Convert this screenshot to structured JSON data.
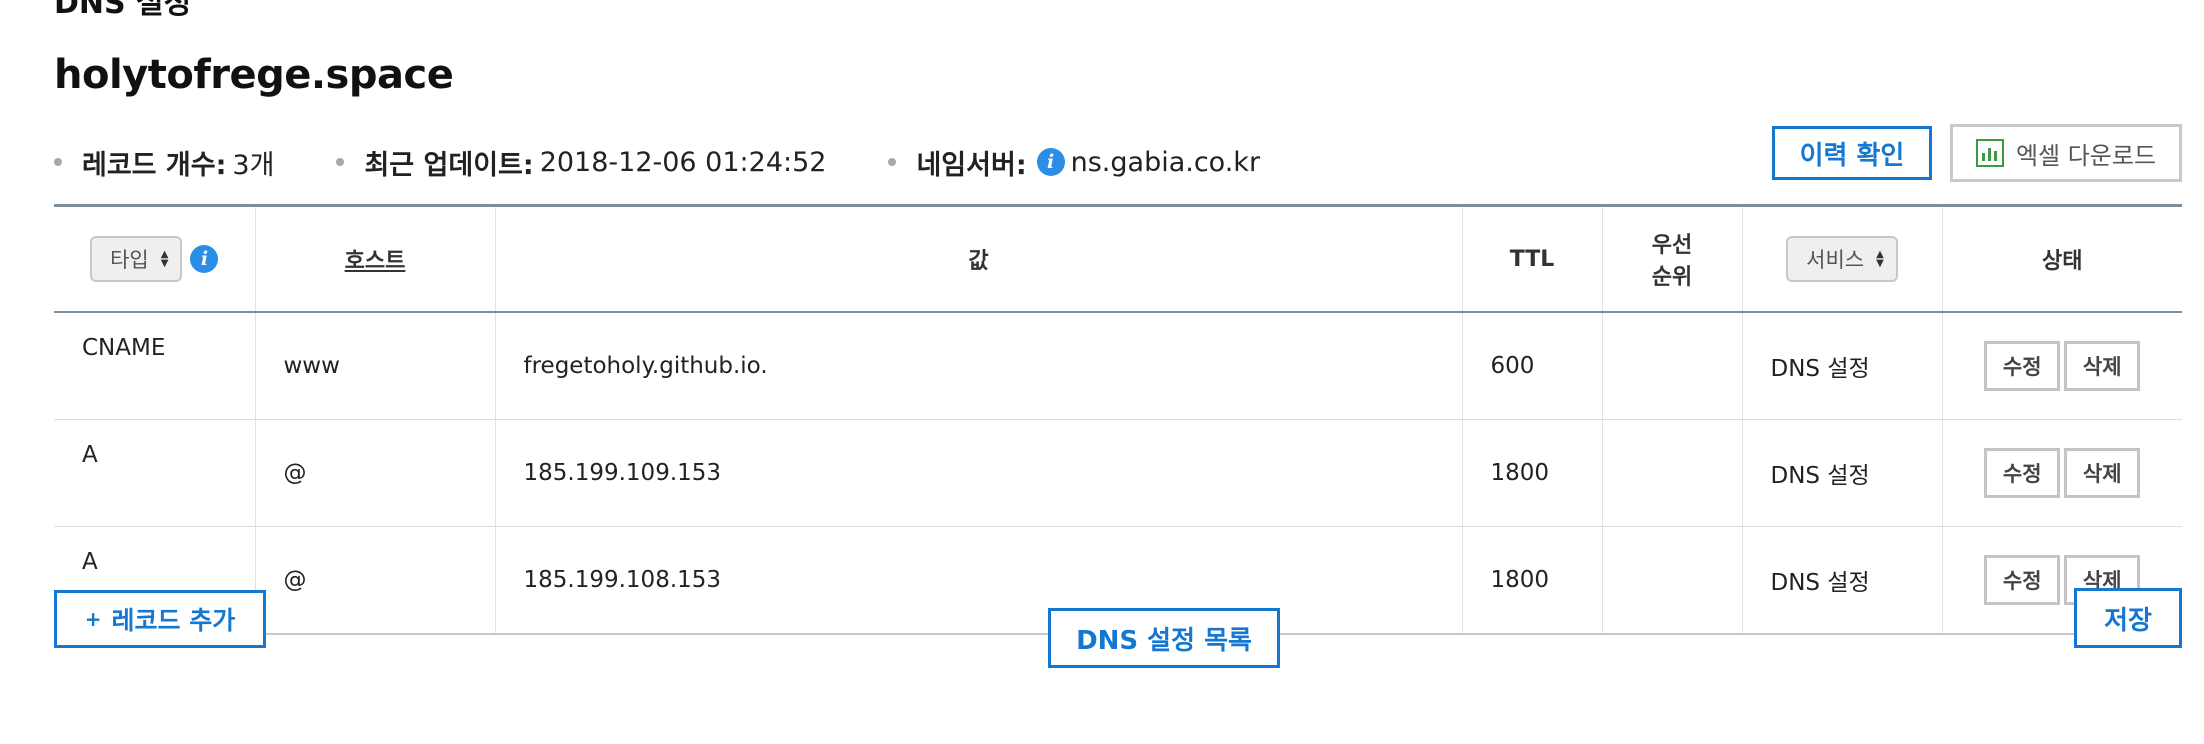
{
  "section_title": "DNS 설정",
  "domain": "holytofrege.space",
  "summary": {
    "record_count_label": "레코드 개수:",
    "record_count_value": "3개",
    "updated_label": "최근 업데이트:",
    "updated_value": "2018-12-06 01:24:52",
    "nameserver_label": "네임서버:",
    "nameserver_value": "ns.gabia.co.kr"
  },
  "buttons": {
    "history": "이력 확인",
    "excel": "엑셀 다운로드",
    "add_record": "레코드 추가",
    "dns_list": "DNS 설정 목록",
    "save": "저장",
    "edit": "수정",
    "delete": "삭제"
  },
  "table": {
    "headers": {
      "type": "타입",
      "host": "호스트",
      "value": "값",
      "ttl": "TTL",
      "priority_line1": "우선",
      "priority_line2": "순위",
      "service": "서비스",
      "status": "상태"
    },
    "rows": [
      {
        "type": "CNAME",
        "host": "www",
        "value": "fregetoholy.github.io.",
        "ttl": "600",
        "priority": "",
        "service": "DNS 설정"
      },
      {
        "type": "A",
        "host": "@",
        "value": "185.199.109.153",
        "ttl": "1800",
        "priority": "",
        "service": "DNS 설정"
      },
      {
        "type": "A",
        "host": "@",
        "value": "185.199.108.153",
        "ttl": "1800",
        "priority": "",
        "service": "DNS 설정"
      }
    ]
  },
  "icons": {
    "info": "info-icon",
    "excel": "excel-chart-icon",
    "sort": "sort-arrows-icon"
  },
  "colors": {
    "accent": "#1477d1",
    "info": "#2a8ee6",
    "excel": "#3c9a45",
    "header_border": "#7d8e9c"
  }
}
